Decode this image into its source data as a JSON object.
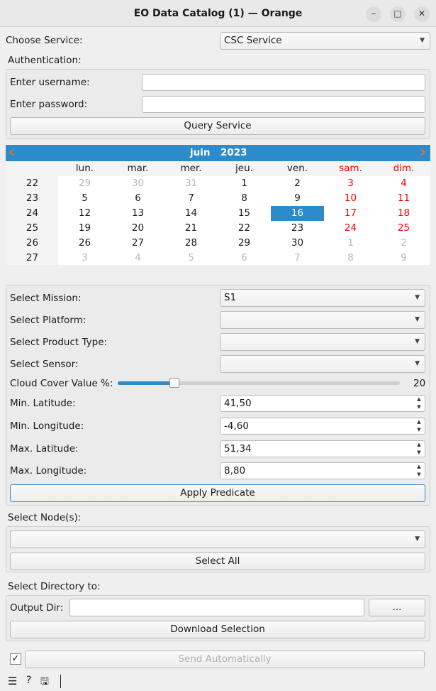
{
  "window": {
    "title": "EO Data Catalog (1) — Orange",
    "minimize": "–",
    "maximize": "□",
    "close": "✕"
  },
  "service": {
    "label": "Choose Service:",
    "value": "CSC Service"
  },
  "auth": {
    "label": "Authentication:",
    "username_label": "Enter username:",
    "username": "",
    "password_label": "Enter password:",
    "password": "",
    "query_button": "Query Service"
  },
  "calendar": {
    "month": "juin",
    "year": "2023",
    "prev": "‹",
    "next": "›",
    "day_names": [
      "lun.",
      "mar.",
      "mer.",
      "jeu.",
      "ven.",
      "sam.",
      "dim."
    ],
    "weeks": [
      "22",
      "23",
      "24",
      "25",
      "26",
      "27"
    ],
    "rows": [
      [
        "29",
        "30",
        "31",
        "1",
        "2",
        "3",
        "4"
      ],
      [
        "5",
        "6",
        "7",
        "8",
        "9",
        "10",
        "11"
      ],
      [
        "12",
        "13",
        "14",
        "15",
        "16",
        "17",
        "18"
      ],
      [
        "19",
        "20",
        "21",
        "22",
        "23",
        "24",
        "25"
      ],
      [
        "26",
        "27",
        "28",
        "29",
        "30",
        "1",
        "2"
      ],
      [
        "3",
        "4",
        "5",
        "6",
        "7",
        "8",
        "9"
      ]
    ],
    "selected": "16",
    "colors": {
      "accent": "#2e8bc9",
      "weekend": "#ff0000",
      "other_month": "#b8b8b8"
    }
  },
  "filters": {
    "mission_label": "Select Mission:",
    "mission": "S1",
    "platform_label": "Select Platform:",
    "platform": "",
    "product_label": "Select Product Type:",
    "product": "",
    "sensor_label": "Select Sensor:",
    "sensor": "",
    "cloud_label": "Cloud Cover Value %:",
    "cloud_value": "20",
    "cloud_max": 100,
    "min_lat_label": "Min. Latitude:",
    "min_lat": "41,50",
    "min_lon_label": "Min. Longitude:",
    "min_lon": "-4,60",
    "max_lat_label": "Max. Latitude:",
    "max_lat": "51,34",
    "max_lon_label": "Max. Longitude:",
    "max_lon": "8,80",
    "apply_button": "Apply Predicate"
  },
  "nodes": {
    "label": "Select Node(s):",
    "value": "",
    "select_all": "Select All"
  },
  "directory": {
    "label": "Select Directory to:",
    "output_label": "Output Dir:",
    "output": "",
    "browse": "...",
    "download": "Download Selection"
  },
  "footer": {
    "send_auto": "Send Automatically",
    "auto_checked": true,
    "check": "✓",
    "menu": "☰",
    "help": "?",
    "save": "🖫"
  }
}
